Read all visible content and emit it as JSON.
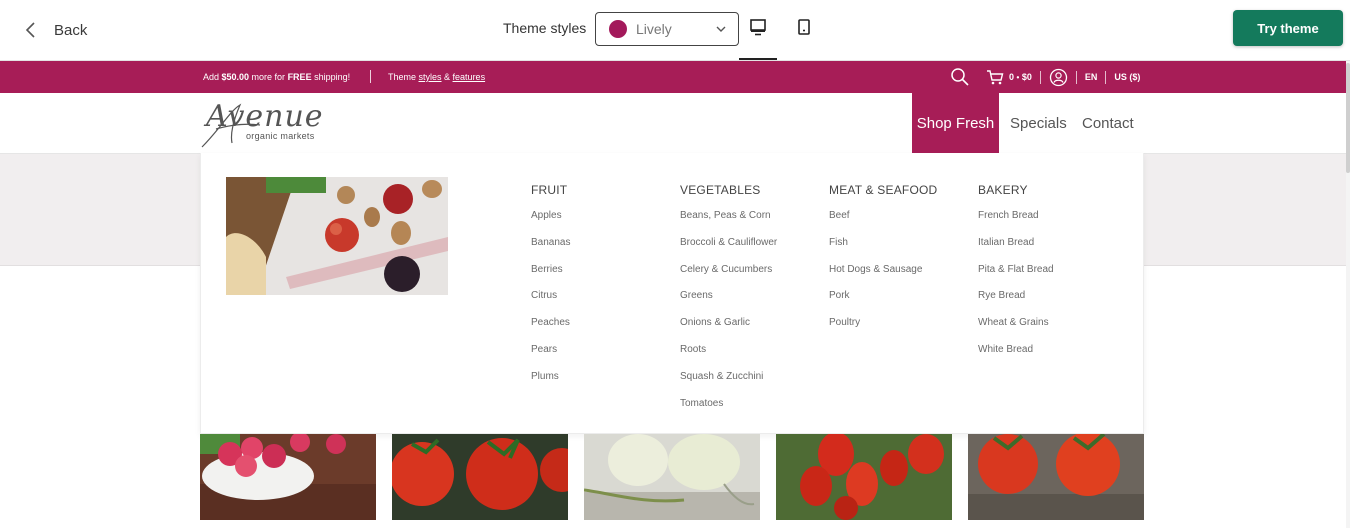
{
  "toolbar": {
    "back_label": "Back",
    "theme_styles_label": "Theme styles",
    "theme_selected": "Lively",
    "theme_swatch_color": "#a3195b",
    "try_theme_label": "Try theme",
    "try_theme_color": "#147a5c"
  },
  "announcement": {
    "bg_color": "#a71d57",
    "shipping_prefix": "Add ",
    "shipping_amount": "$50.00",
    "shipping_middle": " more for ",
    "shipping_free": "FREE",
    "shipping_suffix": " shipping!",
    "theme_prefix": "Theme ",
    "styles_link": "styles",
    "amp": " & ",
    "features_link": "features",
    "cart_count": "0",
    "cart_dot": "•",
    "cart_total": "$0",
    "language": "EN",
    "currency": "US ($)"
  },
  "store": {
    "logo_script": "Avenue",
    "logo_sub": "organic markets",
    "nav": [
      "Shop Fresh",
      "Specials",
      "Contact"
    ],
    "active_color": "#a71d57"
  },
  "mega_menu": {
    "columns": [
      {
        "title": "FRUIT",
        "items": [
          "Apples",
          "Bananas",
          "Berries",
          "Citrus",
          "Peaches",
          "Pears",
          "Plums"
        ]
      },
      {
        "title": "VEGETABLES",
        "items": [
          "Beans, Peas & Corn",
          "Broccoli & Cauliflower",
          "Celery & Cucumbers",
          "Greens",
          "Onions & Garlic",
          "Roots",
          "Squash & Zucchini",
          "Tomatoes"
        ]
      },
      {
        "title": "MEAT & SEAFOOD",
        "items": [
          "Beef",
          "Fish",
          "Hot Dogs & Sausage",
          "Pork",
          "Poultry"
        ]
      },
      {
        "title": "BAKERY",
        "items": [
          "French Bread",
          "Italian Bread",
          "Pita & Flat Bread",
          "Rye Bread",
          "Wheat & Grains",
          "White Bread"
        ]
      }
    ]
  },
  "icons": [
    "chevron-left-icon",
    "chevron-down-icon",
    "desktop-icon",
    "mobile-icon",
    "search-icon",
    "cart-icon",
    "account-icon"
  ]
}
